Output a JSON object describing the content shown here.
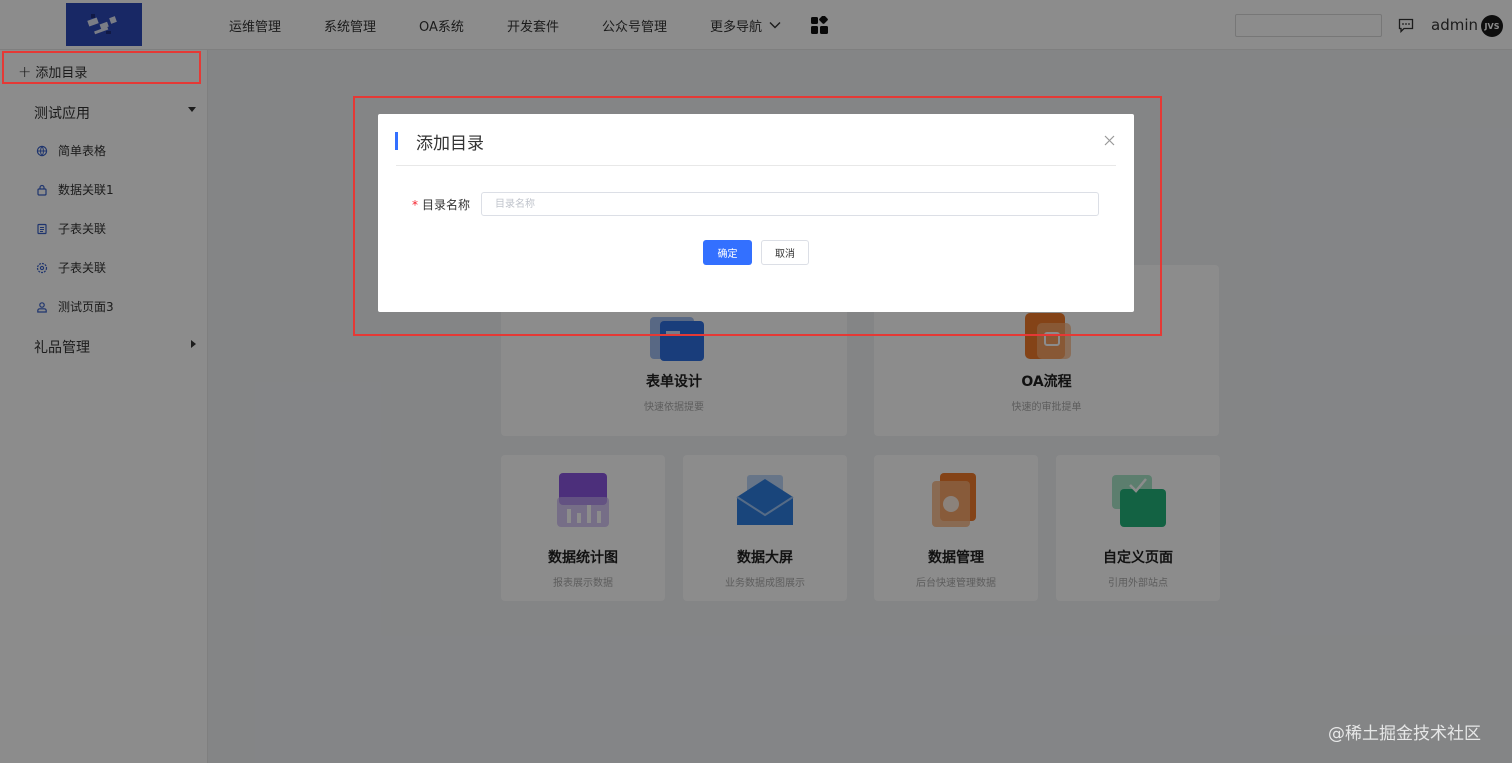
{
  "header": {
    "nav": [
      "运维管理",
      "系统管理",
      "OA系统",
      "开发套件",
      "公众号管理"
    ],
    "more_nav": "更多导航",
    "user": "admin",
    "avatar_text": "JVS"
  },
  "sidebar": {
    "add_label": "添加目录",
    "groups": [
      {
        "title": "测试应用",
        "expanded": true,
        "items": [
          {
            "label": "简单表格",
            "icon": "globe-icon"
          },
          {
            "label": "数据关联1",
            "icon": "lock-icon"
          },
          {
            "label": "子表关联",
            "icon": "document-icon"
          },
          {
            "label": "子表关联",
            "icon": "gear-icon"
          },
          {
            "label": "测试页面3",
            "icon": "user-icon"
          }
        ]
      },
      {
        "title": "礼品管理",
        "expanded": false
      }
    ]
  },
  "cards": [
    {
      "title": "表单设计",
      "desc": "快速依据提要",
      "color": "#2f6fe0"
    },
    {
      "title": "OA流程",
      "desc": "快速的审批提单",
      "color": "#f07a2a"
    },
    {
      "title": "数据统计图",
      "desc": "报表展示数据",
      "color": "#8a56e0"
    },
    {
      "title": "数据大屏",
      "desc": "业务数据成图展示",
      "color": "#2f7fe0"
    },
    {
      "title": "数据管理",
      "desc": "后台快速管理数据",
      "color": "#f07a2a"
    },
    {
      "title": "自定义页面",
      "desc": "引用外部站点",
      "color": "#24b37a"
    }
  ],
  "modal": {
    "title": "添加目录",
    "field_label": "目录名称",
    "required_mark": "*",
    "field_placeholder": "目录名称",
    "field_value": "",
    "ok_label": "确定",
    "cancel_label": "取消"
  },
  "watermark": "@稀土掘金技术社区",
  "colors": {
    "primary": "#3370ff",
    "highlight": "#e53935"
  }
}
